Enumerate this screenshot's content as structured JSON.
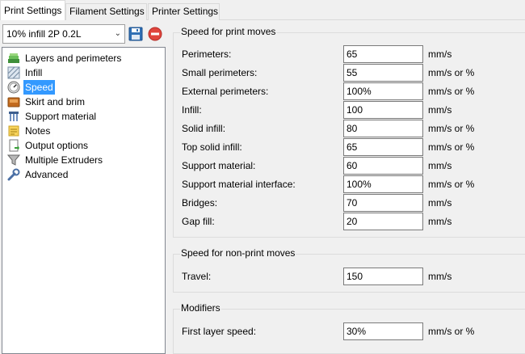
{
  "tabs": [
    {
      "label": "Print Settings",
      "active": true
    },
    {
      "label": "Filament Settings",
      "active": false
    },
    {
      "label": "Printer Settings",
      "active": false
    }
  ],
  "preset": {
    "selected": "10% infill 2P 0.2L"
  },
  "sidebar": {
    "items": [
      {
        "label": "Layers and perimeters",
        "icon": "layers-icon"
      },
      {
        "label": "Infill",
        "icon": "infill-icon"
      },
      {
        "label": "Speed",
        "icon": "speed-icon",
        "selected": true
      },
      {
        "label": "Skirt and brim",
        "icon": "skirt-icon"
      },
      {
        "label": "Support material",
        "icon": "support-icon"
      },
      {
        "label": "Notes",
        "icon": "notes-icon"
      },
      {
        "label": "Output options",
        "icon": "output-icon"
      },
      {
        "label": "Multiple Extruders",
        "icon": "funnel-icon"
      },
      {
        "label": "Advanced",
        "icon": "wrench-icon"
      }
    ]
  },
  "groups": [
    {
      "title": "Speed for print moves",
      "rows": [
        {
          "label": "Perimeters:",
          "value": "65",
          "unit": "mm/s"
        },
        {
          "label": "Small perimeters:",
          "value": "55",
          "unit": "mm/s or %"
        },
        {
          "label": "External perimeters:",
          "value": "100%",
          "unit": "mm/s or %"
        },
        {
          "label": "Infill:",
          "value": "100",
          "unit": "mm/s"
        },
        {
          "label": "Solid infill:",
          "value": "80",
          "unit": "mm/s or %"
        },
        {
          "label": "Top solid infill:",
          "value": "65",
          "unit": "mm/s or %"
        },
        {
          "label": "Support material:",
          "value": "60",
          "unit": "mm/s"
        },
        {
          "label": "Support material interface:",
          "value": "100%",
          "unit": "mm/s or %"
        },
        {
          "label": "Bridges:",
          "value": "70",
          "unit": "mm/s"
        },
        {
          "label": "Gap fill:",
          "value": "20",
          "unit": "mm/s"
        }
      ]
    },
    {
      "title": "Speed for non-print moves",
      "rows": [
        {
          "label": "Travel:",
          "value": "150",
          "unit": "mm/s"
        }
      ]
    },
    {
      "title": "Modifiers",
      "rows": [
        {
          "label": "First layer speed:",
          "value": "30%",
          "unit": "mm/s or %"
        }
      ]
    }
  ],
  "colors": {
    "selection": "#3399ff",
    "delete": "#e0453d",
    "save": "#2f6fb5"
  }
}
